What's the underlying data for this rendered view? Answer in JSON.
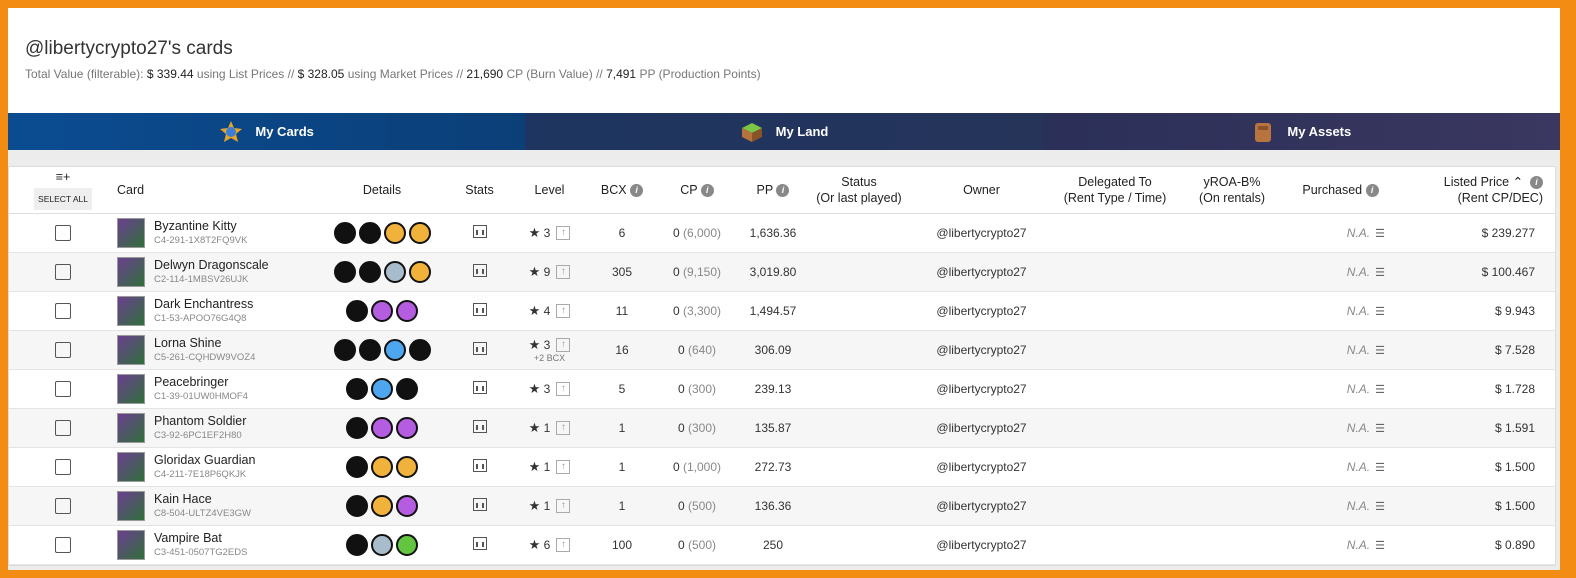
{
  "header": {
    "title": "@libertycrypto27's cards",
    "summary": {
      "total_label": "Total Value (filterable):",
      "list_value": "$ 339.44",
      "list_label": "using List Prices //",
      "market_value": "$ 328.05",
      "market_label": "using Market Prices //",
      "cp_value": "21,690",
      "cp_label": "CP (Burn Value) //",
      "pp_value": "7,491",
      "pp_label": "PP (Production Points)"
    }
  },
  "nav": {
    "tabs": [
      {
        "label": "My Cards",
        "icon": "cards-icon"
      },
      {
        "label": "My Land",
        "icon": "land-icon"
      },
      {
        "label": "My Assets",
        "icon": "assets-icon"
      }
    ]
  },
  "table": {
    "headers": {
      "select_all": "SELECT ALL",
      "select_icon": "≡+",
      "card": "Card",
      "details": "Details",
      "stats": "Stats",
      "level": "Level",
      "bcx": "BCX",
      "cp": "CP",
      "pp": "PP",
      "status": "Status",
      "status_sub": "(Or last played)",
      "owner": "Owner",
      "delegated": "Delegated To",
      "delegated_sub": "(Rent Type / Time)",
      "yroa": "yROA-B%",
      "yroa_sub": "(On rentals)",
      "purchased": "Purchased",
      "listed": "Listed Price",
      "listed_sub": "(Rent CP/DEC)"
    },
    "rows": [
      {
        "name": "Byzantine Kitty",
        "id": "C4-291-1X8T2FQ9VK",
        "level": "3",
        "bcx": "6",
        "cp": "0",
        "cp_max": "(6,000)",
        "pp": "1,636.36",
        "owner": "@libertycrypto27",
        "purchased": "N.A.",
        "price": "$ 239.277",
        "dots": [
          "black",
          "black",
          "gold",
          "gold"
        ],
        "extra": ""
      },
      {
        "name": "Delwyn Dragonscale",
        "id": "C2-114-1MBSV26UJK",
        "level": "9",
        "bcx": "305",
        "cp": "0",
        "cp_max": "(9,150)",
        "pp": "3,019.80",
        "owner": "@libertycrypto27",
        "purchased": "N.A.",
        "price": "$ 100.467",
        "dots": [
          "black",
          "black",
          "silver",
          "gold"
        ],
        "extra": ""
      },
      {
        "name": "Dark Enchantress",
        "id": "C1-53-APOO76G4Q8",
        "level": "4",
        "bcx": "11",
        "cp": "0",
        "cp_max": "(3,300)",
        "pp": "1,494.57",
        "owner": "@libertycrypto27",
        "purchased": "N.A.",
        "price": "$ 9.943",
        "dots": [
          "black",
          "purple",
          "purple"
        ],
        "extra": ""
      },
      {
        "name": "Lorna Shine",
        "id": "C5-261-CQHDW9VOZ4",
        "level": "3",
        "bcx": "16",
        "cp": "0",
        "cp_max": "(640)",
        "pp": "306.09",
        "owner": "@libertycrypto27",
        "purchased": "N.A.",
        "price": "$ 7.528",
        "dots": [
          "black",
          "black",
          "blue",
          "black"
        ],
        "extra": "+2 BCX"
      },
      {
        "name": "Peacebringer",
        "id": "C1-39-01UW0HMOF4",
        "level": "3",
        "bcx": "5",
        "cp": "0",
        "cp_max": "(300)",
        "pp": "239.13",
        "owner": "@libertycrypto27",
        "purchased": "N.A.",
        "price": "$ 1.728",
        "dots": [
          "black",
          "blue",
          "black"
        ],
        "extra": ""
      },
      {
        "name": "Phantom Soldier",
        "id": "C3-92-6PC1EF2H80",
        "level": "1",
        "bcx": "1",
        "cp": "0",
        "cp_max": "(300)",
        "pp": "135.87",
        "owner": "@libertycrypto27",
        "purchased": "N.A.",
        "price": "$ 1.591",
        "dots": [
          "black",
          "purple",
          "purple"
        ],
        "extra": ""
      },
      {
        "name": "Gloridax Guardian",
        "id": "C4-211-7E18P6QKJK",
        "level": "1",
        "bcx": "1",
        "cp": "0",
        "cp_max": "(1,000)",
        "pp": "272.73",
        "owner": "@libertycrypto27",
        "purchased": "N.A.",
        "price": "$ 1.500",
        "dots": [
          "black",
          "gold",
          "gold"
        ],
        "extra": ""
      },
      {
        "name": "Kain Hace",
        "id": "C8-504-ULTZ4VE3GW",
        "level": "1",
        "bcx": "1",
        "cp": "0",
        "cp_max": "(500)",
        "pp": "136.36",
        "owner": "@libertycrypto27",
        "purchased": "N.A.",
        "price": "$ 1.500",
        "dots": [
          "black",
          "gold",
          "purple"
        ],
        "extra": ""
      },
      {
        "name": "Vampire Bat",
        "id": "C3-451-0507TG2EDS",
        "level": "6",
        "bcx": "100",
        "cp": "0",
        "cp_max": "(500)",
        "pp": "250",
        "owner": "@libertycrypto27",
        "purchased": "N.A.",
        "price": "$ 0.890",
        "dots": [
          "black",
          "silver",
          "green"
        ],
        "extra": ""
      }
    ]
  },
  "colors": {
    "accent_border": "#f28c13",
    "nav_active": "#0b4c91"
  }
}
